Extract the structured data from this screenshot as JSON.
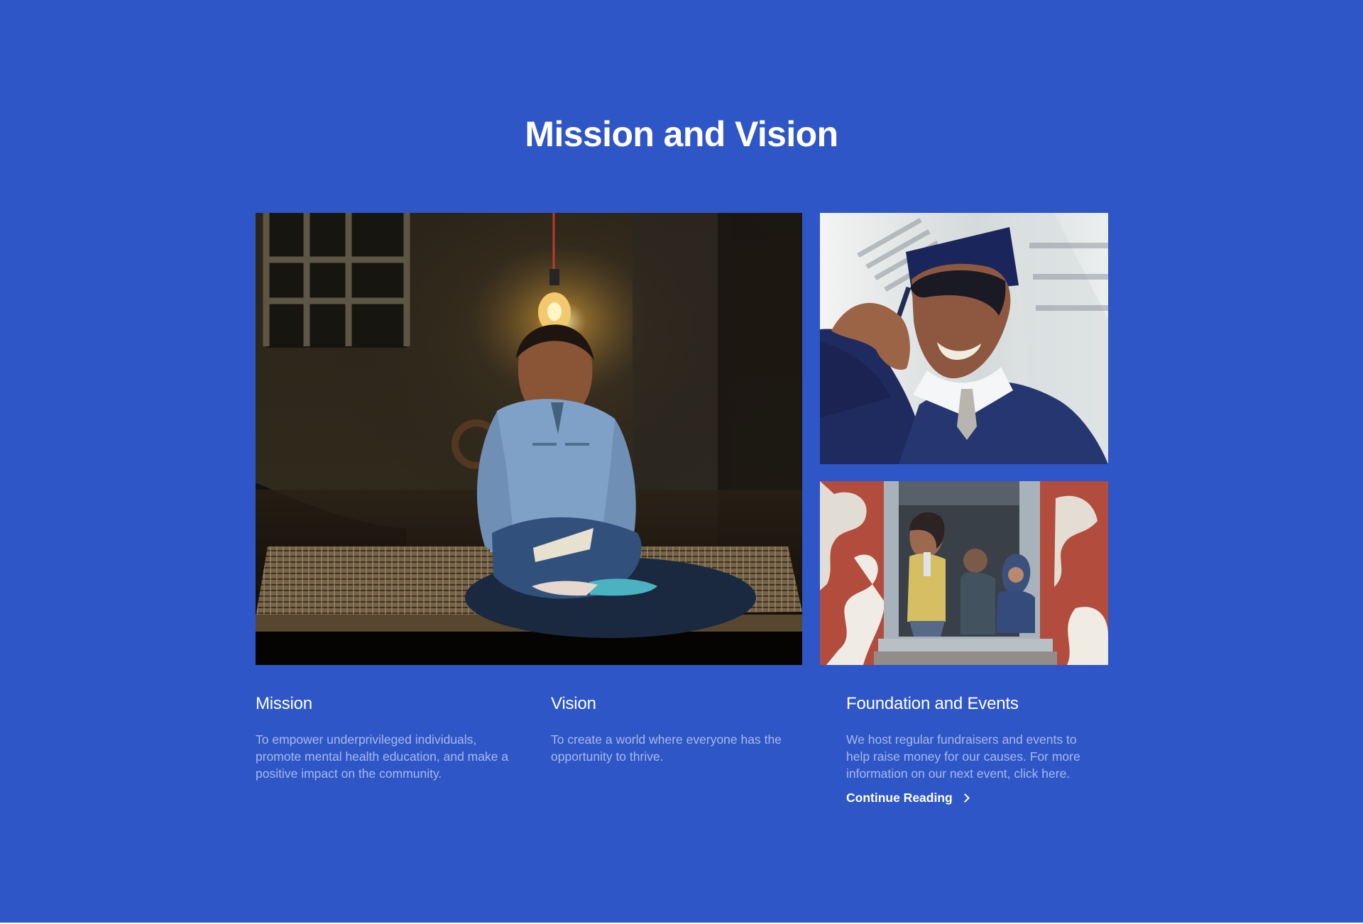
{
  "section": {
    "title": "Mission and Vision",
    "background_color": "#2f56c6",
    "body_text_color": "#a6b9eb",
    "heading_color": "#ffffff"
  },
  "images": {
    "main": {
      "description": "student-with-book-under-lightbulb"
    },
    "top_right": {
      "description": "graduate-in-cap-and-gown"
    },
    "bottom_right": {
      "description": "children-in-window"
    }
  },
  "columns": [
    {
      "heading": "Mission",
      "text": "To empower underprivileged individuals, promote mental health education, and make a positive impact on the community."
    },
    {
      "heading": "Vision",
      "text": "To create a world where everyone has the opportunity to thrive."
    },
    {
      "heading": "Foundation and Events",
      "text": "We host regular fundraisers and events to help raise money for our causes. For more information on our next event, click here.",
      "link_label": "Continue Reading"
    }
  ]
}
